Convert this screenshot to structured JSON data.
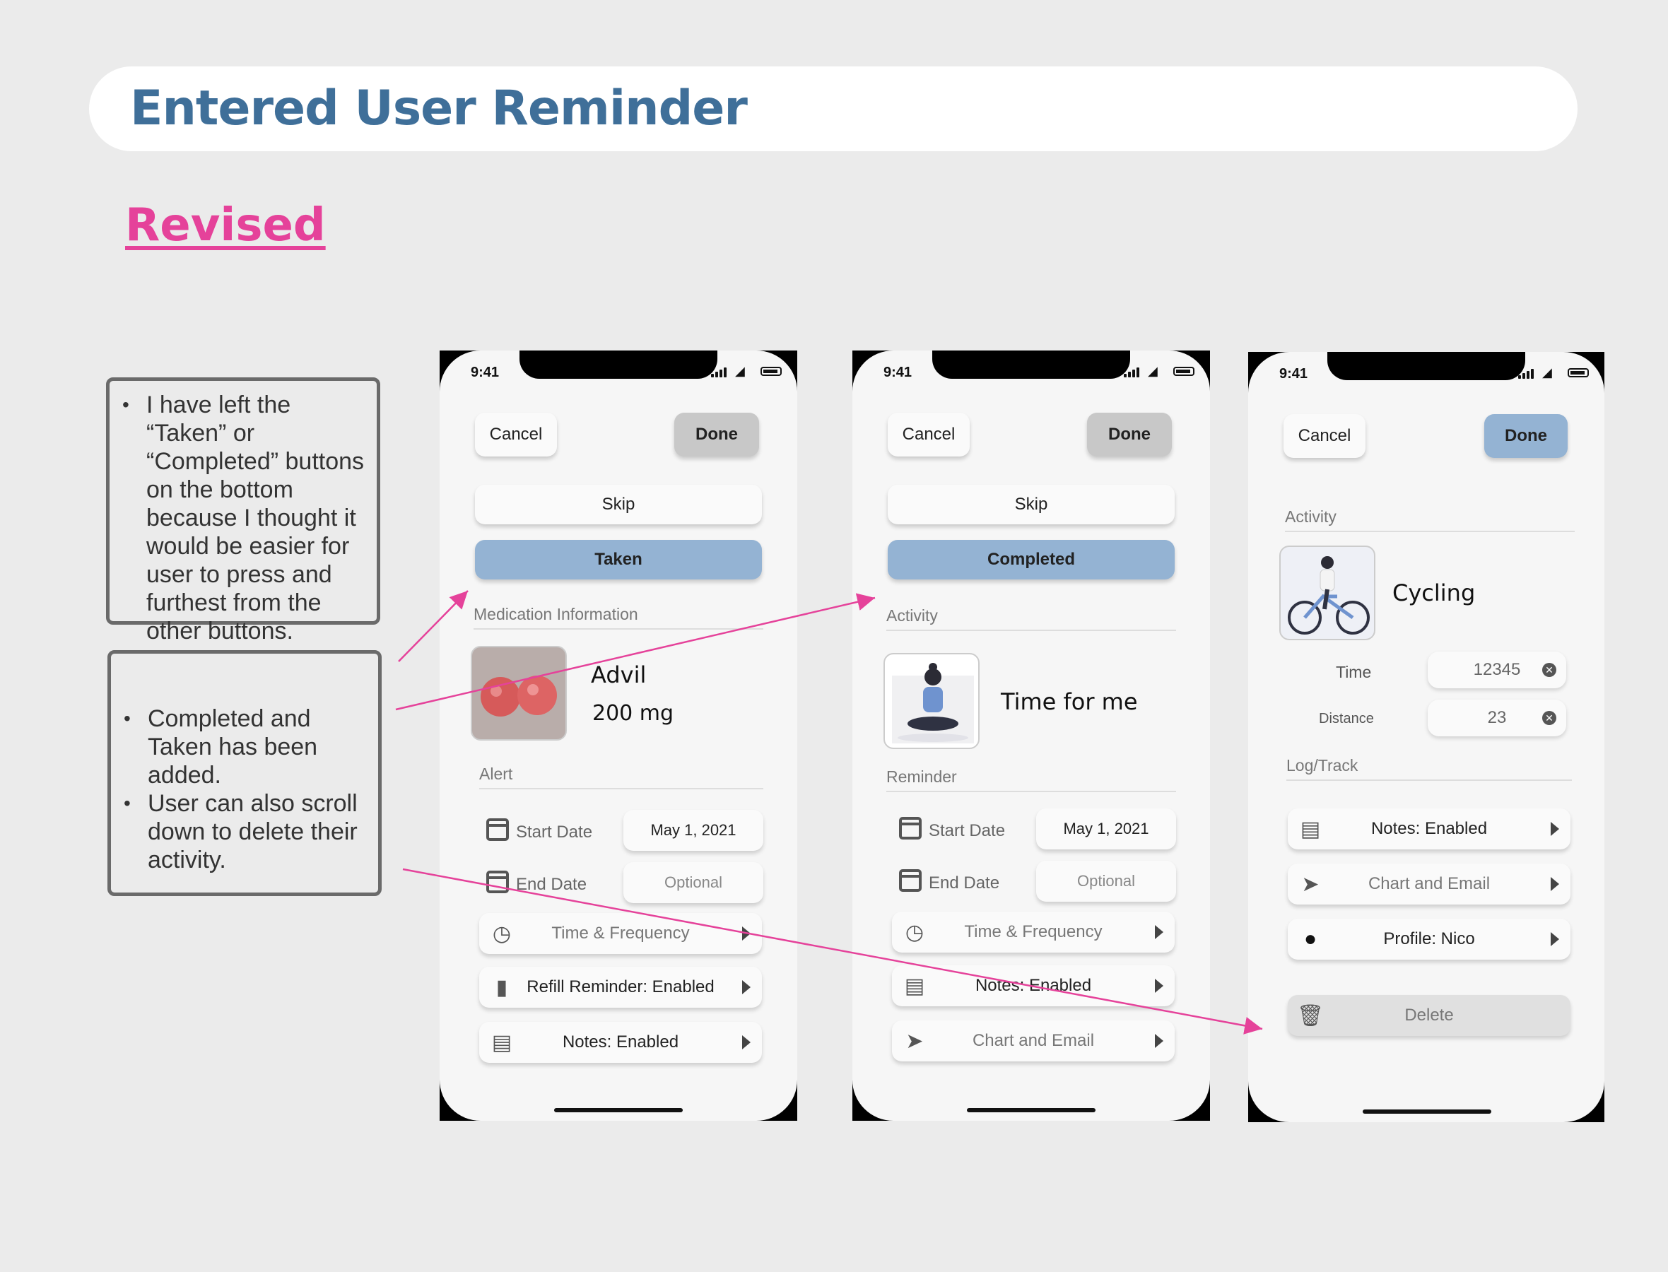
{
  "header": {
    "title": "Entered User Reminder"
  },
  "subtitle": "Revised",
  "notes": {
    "note1": [
      "I have left the “Taken” or “Completed” buttons on the bottom because I thought it would be easier for user to press and furthest from the other buttons."
    ],
    "note2": [
      "Completed and Taken has been added.",
      "User can also scroll down to delete their activity."
    ]
  },
  "phone1": {
    "time": "9:41",
    "cancel": "Cancel",
    "done": "Done",
    "skip": "Skip",
    "primary": "Taken",
    "section1": "Medication Information",
    "med_name": "Advil",
    "med_dose": "200 mg",
    "section2": "Alert",
    "start_label": "Start Date",
    "start_value": "May 1, 2021",
    "end_label": "End Date",
    "end_value": "Optional",
    "rows": [
      "Time & Frequency",
      "Refill Reminder: Enabled",
      "Notes: Enabled"
    ]
  },
  "phone2": {
    "time": "9:41",
    "cancel": "Cancel",
    "done": "Done",
    "skip": "Skip",
    "primary": "Completed",
    "section1": "Activity",
    "activity_name": "Time for me",
    "section2": "Reminder",
    "start_label": "Start Date",
    "start_value": "May 1, 2021",
    "end_label": "End Date",
    "end_value": "Optional",
    "rows": [
      "Time & Frequency",
      "Notes: Enabled",
      "Chart and Email"
    ]
  },
  "phone3": {
    "time": "9:41",
    "cancel": "Cancel",
    "done": "Done",
    "section1": "Activity",
    "activity_name": "Cycling",
    "time_label": "Time",
    "time_value": "12345",
    "distance_label": "Distance",
    "distance_value": "23",
    "section2": "Log/Track",
    "rows": [
      "Notes: Enabled",
      "Chart and Email",
      "Profile: Nico"
    ],
    "delete": "Delete"
  },
  "colors": {
    "accent_blue": "#94b3d3",
    "title_blue": "#3f6f99",
    "pink": "#e5429a"
  }
}
